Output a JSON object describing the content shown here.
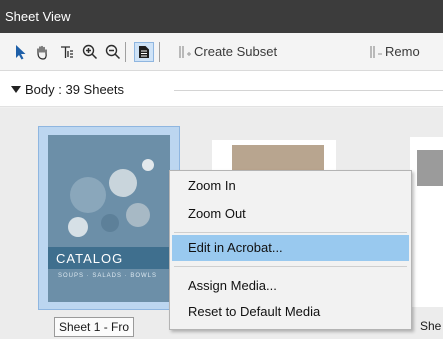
{
  "window": {
    "title": "Sheet View"
  },
  "toolbar": {
    "tools": [
      {
        "icon": "arrow-cursor-icon"
      },
      {
        "icon": "hand-pan-icon"
      },
      {
        "icon": "text-select-icon"
      },
      {
        "icon": "zoom-in-icon"
      },
      {
        "icon": "zoom-out-icon"
      },
      {
        "icon": "page-view-icon"
      }
    ],
    "create_subset_label": "Create Subset",
    "remove_label": "Remo"
  },
  "section": {
    "title": "Body : 39 Sheets"
  },
  "sheets": [
    {
      "label": "Sheet 1 - Fro",
      "cover_word": "CATALOG",
      "cover_sub": "SOUPS · SALADS · BOWLS"
    },
    {
      "label": ""
    },
    {
      "label": "She"
    }
  ],
  "context_menu": {
    "items": [
      "Zoom In",
      "Zoom Out",
      "Edit in Acrobat...",
      "Assign Media...",
      "Reset to Default Media"
    ],
    "highlighted": "Edit in Acrobat..."
  },
  "colors": {
    "titlebar": "#3c3c3c",
    "selection": "#bcd6f0",
    "menu_highlight": "#99c9ef",
    "accent_icon": "#1e5fa8"
  }
}
